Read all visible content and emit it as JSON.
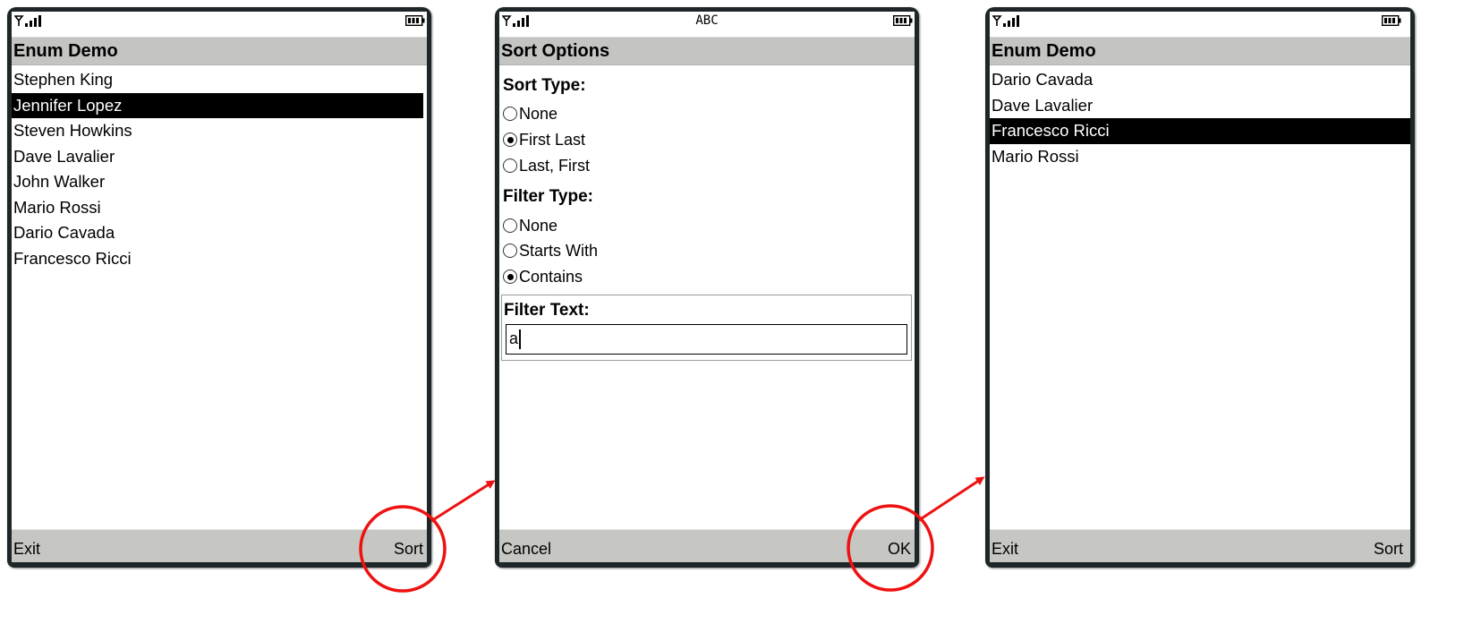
{
  "screens": [
    {
      "title": "Enum Demo",
      "items": [
        "Stephen King",
        "Jennifer Lopez",
        "Steven Howkins",
        "Dave Lavalier",
        "John Walker",
        "Mario Rossi",
        "Dario Cavada",
        "Francesco Ricci"
      ],
      "selected_index": 1,
      "soft_left": "Exit",
      "soft_right": "Sort"
    },
    {
      "title": "Sort Options",
      "input_mode": "ABC",
      "sort_label": "Sort Type:",
      "sort_options": [
        "None",
        "First Last",
        "Last, First"
      ],
      "sort_selected": 1,
      "filter_label": "Filter Type:",
      "filter_options": [
        "None",
        "Starts With",
        "Contains"
      ],
      "filter_selected": 2,
      "text_label": "Filter Text:",
      "text_value": "a",
      "soft_left": "Cancel",
      "soft_right": "OK"
    },
    {
      "title": "Enum Demo",
      "items": [
        "Dario Cavada",
        "Dave Lavalier",
        "Francesco Ricci",
        "Mario Rossi"
      ],
      "selected_index": 2,
      "soft_left": "Exit",
      "soft_right": "Sort"
    }
  ],
  "icons": {
    "signal": "signal-strength-icon",
    "battery": "battery-icon",
    "highlight": "highlight-circle",
    "arrow": "arrow"
  },
  "colors": {
    "annotation": "#ee1111",
    "bezel": "#1e2628",
    "bar": "#c4c4c2",
    "selection": "#000000"
  }
}
